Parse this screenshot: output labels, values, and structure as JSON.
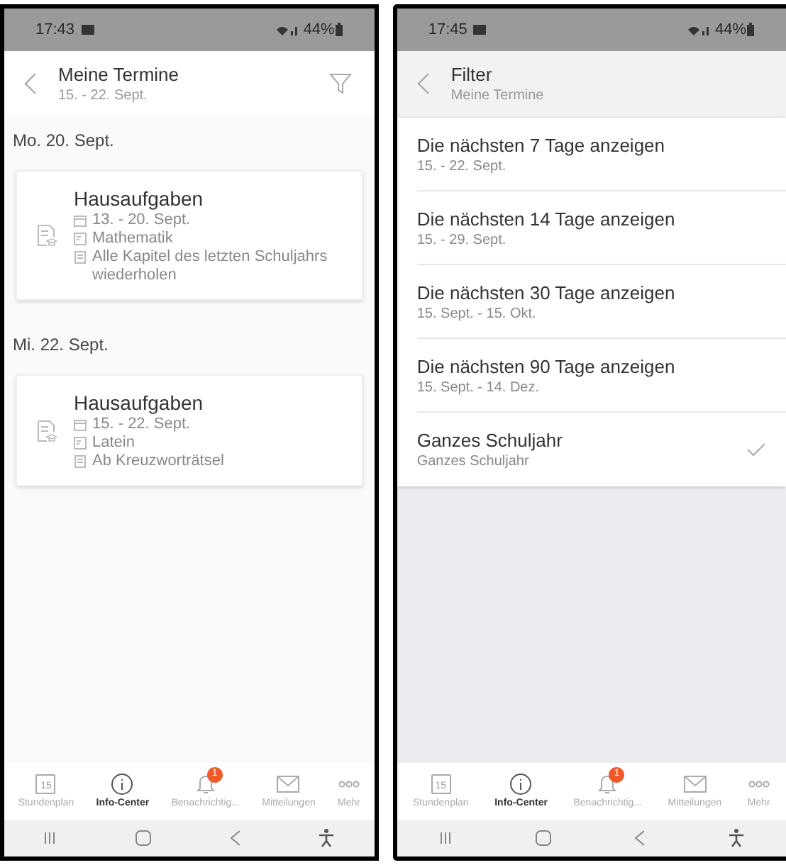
{
  "screens": [
    {
      "kind": "appointments",
      "status_bar": {
        "time": "17:43",
        "battery": "44%"
      },
      "header": {
        "title": "Meine Termine",
        "subtitle": "15. - 22. Sept.",
        "filter": true
      },
      "days": [
        {
          "date": "Mo. 20. Sept.",
          "entries": [
            {
              "title": "Hausaufgaben",
              "dates": "13. - 20. Sept.",
              "subject": "Mathematik",
              "note": "Alle Kapitel des letzten Schuljahrs wiederholen"
            }
          ]
        },
        {
          "date": "Mi. 22. Sept.",
          "entries": [
            {
              "title": "Hausaufgaben",
              "dates": "15. - 22. Sept.",
              "subject": "Latein",
              "note": "Ab Kreuzworträtsel"
            }
          ]
        }
      ],
      "nav": [
        {
          "label": "Stundenplan",
          "icon_text": "15",
          "selected": false
        },
        {
          "label": "Info-Center",
          "selected": true
        },
        {
          "label": "Benachrichtig...",
          "badge": "1",
          "selected": false
        },
        {
          "label": "Mitteilungen",
          "selected": false
        },
        {
          "label": "Mehr",
          "selected": false
        }
      ]
    },
    {
      "kind": "filter",
      "status_bar": {
        "time": "17:45",
        "battery": "44%"
      },
      "header": {
        "title": "Filter",
        "subtitle": "Meine Termine",
        "filter": false
      },
      "options": [
        {
          "title": "Die nächsten 7 Tage anzeigen",
          "subtitle": "15. - 22. Sept.",
          "selected": false
        },
        {
          "title": "Die nächsten 14 Tage anzeigen",
          "subtitle": "15. - 29. Sept.",
          "selected": false
        },
        {
          "title": "Die nächsten 30 Tage anzeigen",
          "subtitle": "15. Sept. - 15. Okt.",
          "selected": false
        },
        {
          "title": "Die nächsten 90 Tage anzeigen",
          "subtitle": "15. Sept. - 14. Dez.",
          "selected": false
        },
        {
          "title": "Ganzes Schuljahr",
          "subtitle": "Ganzes Schuljahr",
          "selected": true
        }
      ],
      "nav": [
        {
          "label": "Stundenplan",
          "icon_text": "15",
          "selected": false
        },
        {
          "label": "Info-Center",
          "selected": true
        },
        {
          "label": "Benachrichtig...",
          "badge": "1",
          "selected": false
        },
        {
          "label": "Mitteilungen",
          "selected": false
        },
        {
          "label": "Mehr",
          "selected": false
        }
      ]
    }
  ]
}
